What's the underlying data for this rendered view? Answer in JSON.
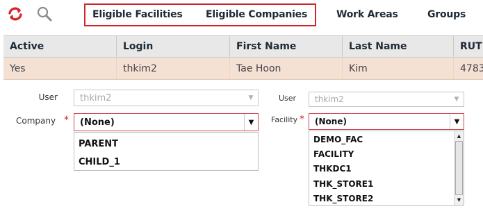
{
  "toolbar": {
    "tabs": [
      "Eligible Facilities",
      "Eligible Companies",
      "Work Areas",
      "Groups"
    ],
    "icons": {
      "refresh": "refresh-icon",
      "search": "magnifier-icon"
    },
    "colors": {
      "refresh": "#d8242b",
      "highlight": "#d0242b"
    }
  },
  "grid": {
    "columns": [
      "Active",
      "Login",
      "First Name",
      "Last Name",
      "RUT"
    ],
    "row": [
      "Yes",
      "thkim2",
      "Tae Hoon",
      "Kim",
      "4783"
    ]
  },
  "company_form": {
    "user_label": "User",
    "user_value": "thkim2",
    "company_label": "Company",
    "required_mark": "*",
    "company_value": "(None)",
    "options": [
      "PARENT",
      "CHILD_1"
    ]
  },
  "facility_form": {
    "user_label": "User",
    "user_value": "thkim2",
    "facility_label": "Facility",
    "required_mark": "*",
    "facility_value": "(None)",
    "options": [
      "DEMO_FAC",
      "FACILITY",
      "THKDC1",
      "THK_STORE1",
      "THK_STORE2"
    ]
  }
}
